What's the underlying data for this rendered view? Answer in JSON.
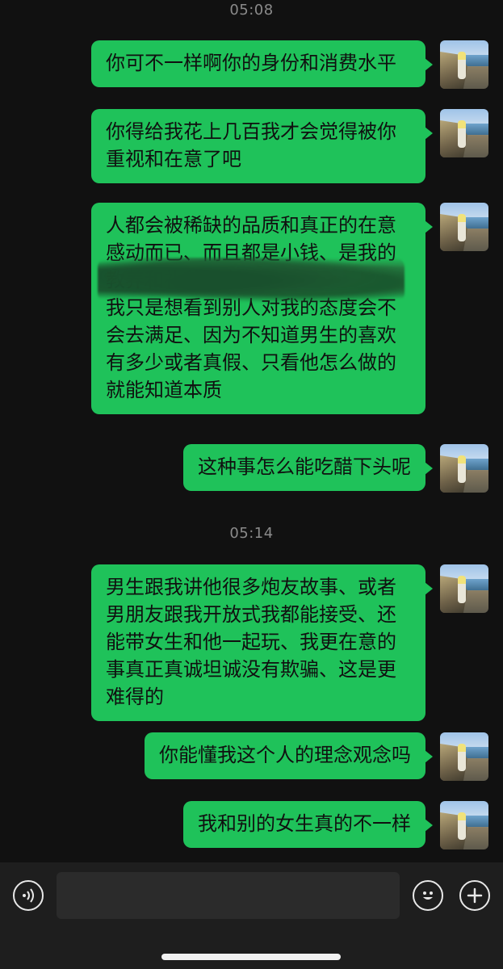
{
  "timestamps": [
    "05:08",
    "05:14"
  ],
  "messages": [
    {
      "text": "你可不一样啊你的身份和消费水平",
      "from": "me"
    },
    {
      "text": "你得给我花上几百我才会觉得被你重视和在意了吧",
      "from": "me"
    },
    {
      "text": "人都会被稀缺的品质和真正的在意感动而已、而且都是小钱、是我的教养和礼貌行为",
      "text_after_redaction": "我只是想看到别人对我的态度会不会去满足、因为不知道男生的喜欢有多少或者真假、只看他怎么做的就能知道本质",
      "from": "me"
    },
    {
      "text": "这种事怎么能吃醋下头呢",
      "from": "me"
    },
    {
      "text": "男生跟我讲他很多炮友故事、或者男朋友跟我开放式我都能接受、还能带女生和他一起玩、我更在意的事真正真诚坦诚没有欺骗、这是更难得的",
      "from": "me"
    },
    {
      "text": "你能懂我这个人的理念观念吗",
      "from": "me"
    },
    {
      "text": "我和别的女生真的不一样",
      "from": "me"
    }
  ],
  "input_bar": {
    "placeholder": "",
    "voice_icon": "voice-icon",
    "emoji_icon": "emoji-icon",
    "plus_icon": "plus-icon"
  },
  "colors": {
    "background": "#111111",
    "bubble": "#1fc25a",
    "input_bar": "#1e1e1e"
  }
}
